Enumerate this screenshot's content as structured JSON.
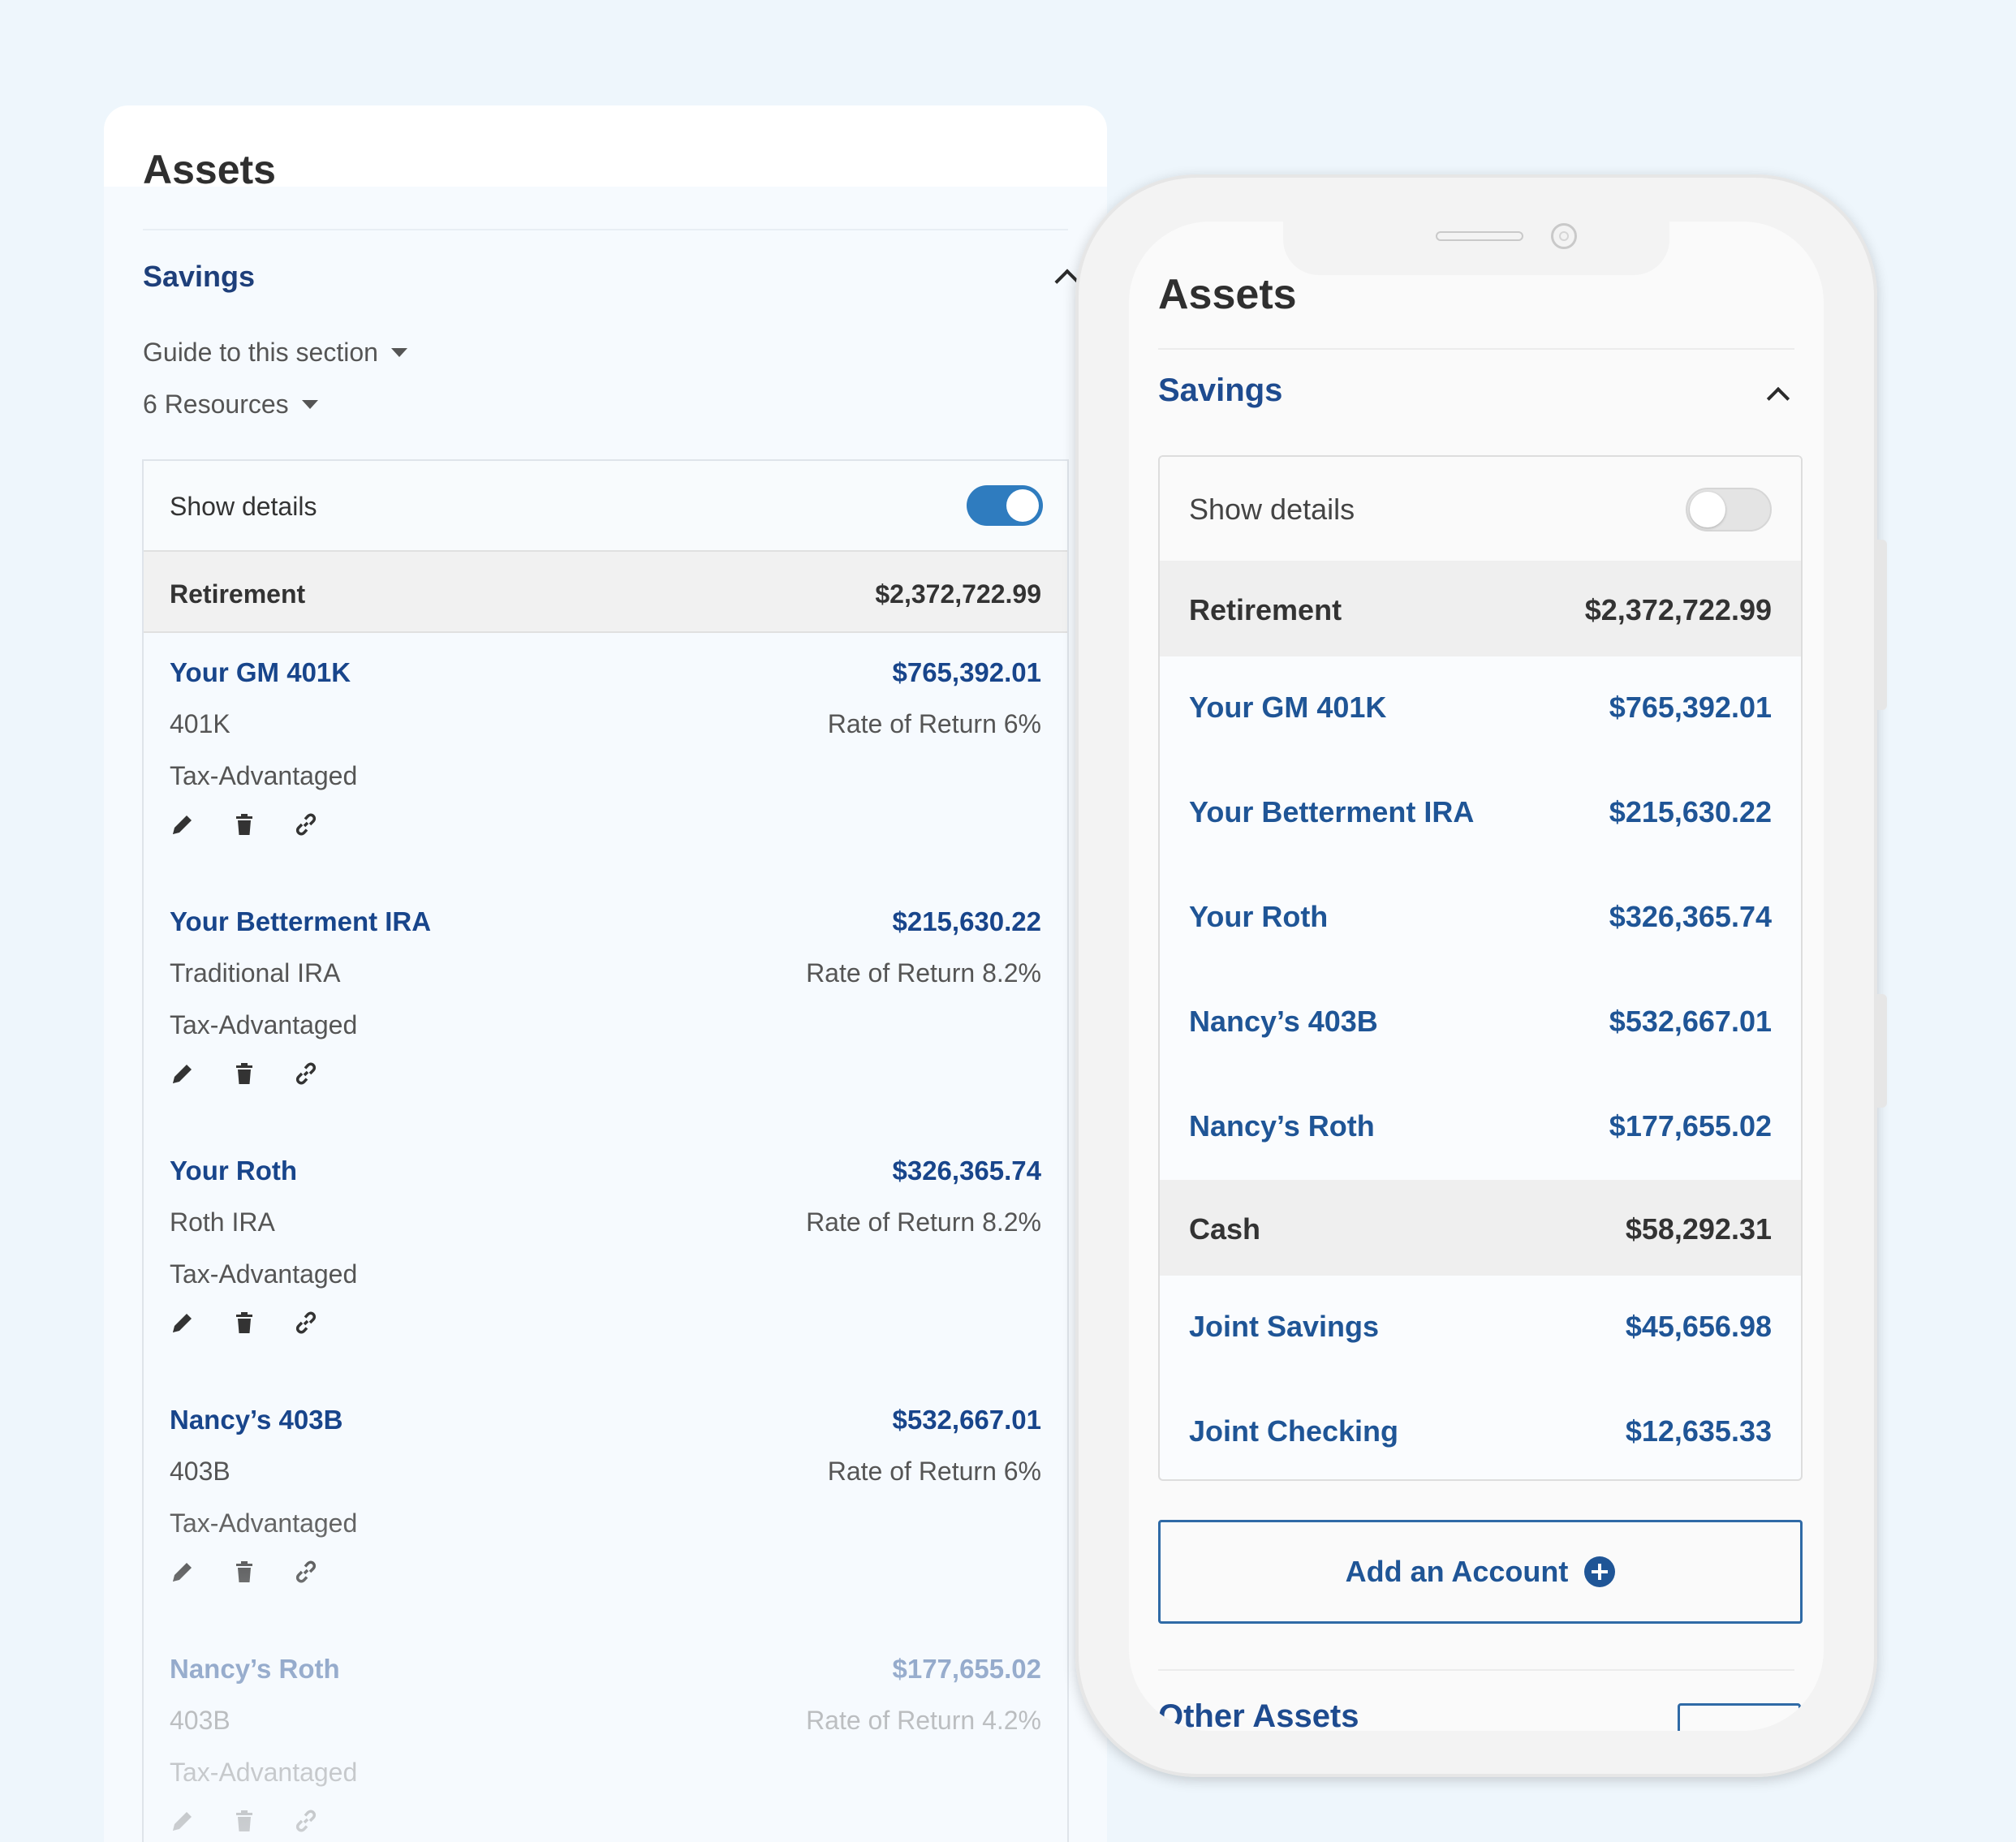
{
  "desktop": {
    "title": "Assets",
    "section": "Savings",
    "guide_label": "Guide to this section",
    "resources_label": "6 Resources",
    "show_details": "Show details",
    "show_details_on": true,
    "group": {
      "label": "Retirement",
      "value": "$2,372,722.99"
    },
    "accounts": [
      {
        "name": "Your GM 401K",
        "value": "$765,392.01",
        "type": "401K",
        "rate": "Rate of Return 6%",
        "tax": "Tax-Advantaged"
      },
      {
        "name": "Your Betterment IRA",
        "value": "$215,630.22",
        "type": "Traditional IRA",
        "rate": "Rate of Return 8.2%",
        "tax": "Tax-Advantaged"
      },
      {
        "name": "Your Roth",
        "value": "$326,365.74",
        "type": "Roth IRA",
        "rate": "Rate of Return 8.2%",
        "tax": "Tax-Advantaged"
      },
      {
        "name": "Nancy’s 403B",
        "value": "$532,667.01",
        "type": "403B",
        "rate": "Rate of Return 6%",
        "tax": "Tax-Advantaged"
      },
      {
        "name": "Nancy’s Roth",
        "value": "$177,655.02",
        "type": "403B",
        "rate": "Rate of Return 4.2%",
        "tax": "Tax-Advantaged"
      }
    ],
    "icons": [
      "pencil-icon",
      "trash-icon",
      "link-icon"
    ]
  },
  "phone": {
    "title": "Assets",
    "section": "Savings",
    "show_details": "Show details",
    "show_details_on": false,
    "groups": [
      {
        "label": "Retirement",
        "value": "$2,372,722.99",
        "rows": [
          {
            "name": "Your GM 401K",
            "value": "$765,392.01"
          },
          {
            "name": "Your Betterment IRA",
            "value": "$215,630.22"
          },
          {
            "name": "Your Roth",
            "value": "$326,365.74"
          },
          {
            "name": "Nancy’s 403B",
            "value": "$532,667.01"
          },
          {
            "name": "Nancy’s Roth",
            "value": "$177,655.02"
          }
        ]
      },
      {
        "label": "Cash",
        "value": "$58,292.31",
        "rows": [
          {
            "name": "Joint Savings",
            "value": "$45,656.98"
          },
          {
            "name": "Joint Checking",
            "value": "$12,635.33"
          }
        ]
      }
    ],
    "add_account": "Add an Account",
    "other_section": "Other Assets"
  },
  "colors": {
    "accent": "#1f5596",
    "toggle_on": "#2f7cbf",
    "background": "#eef6fc"
  }
}
